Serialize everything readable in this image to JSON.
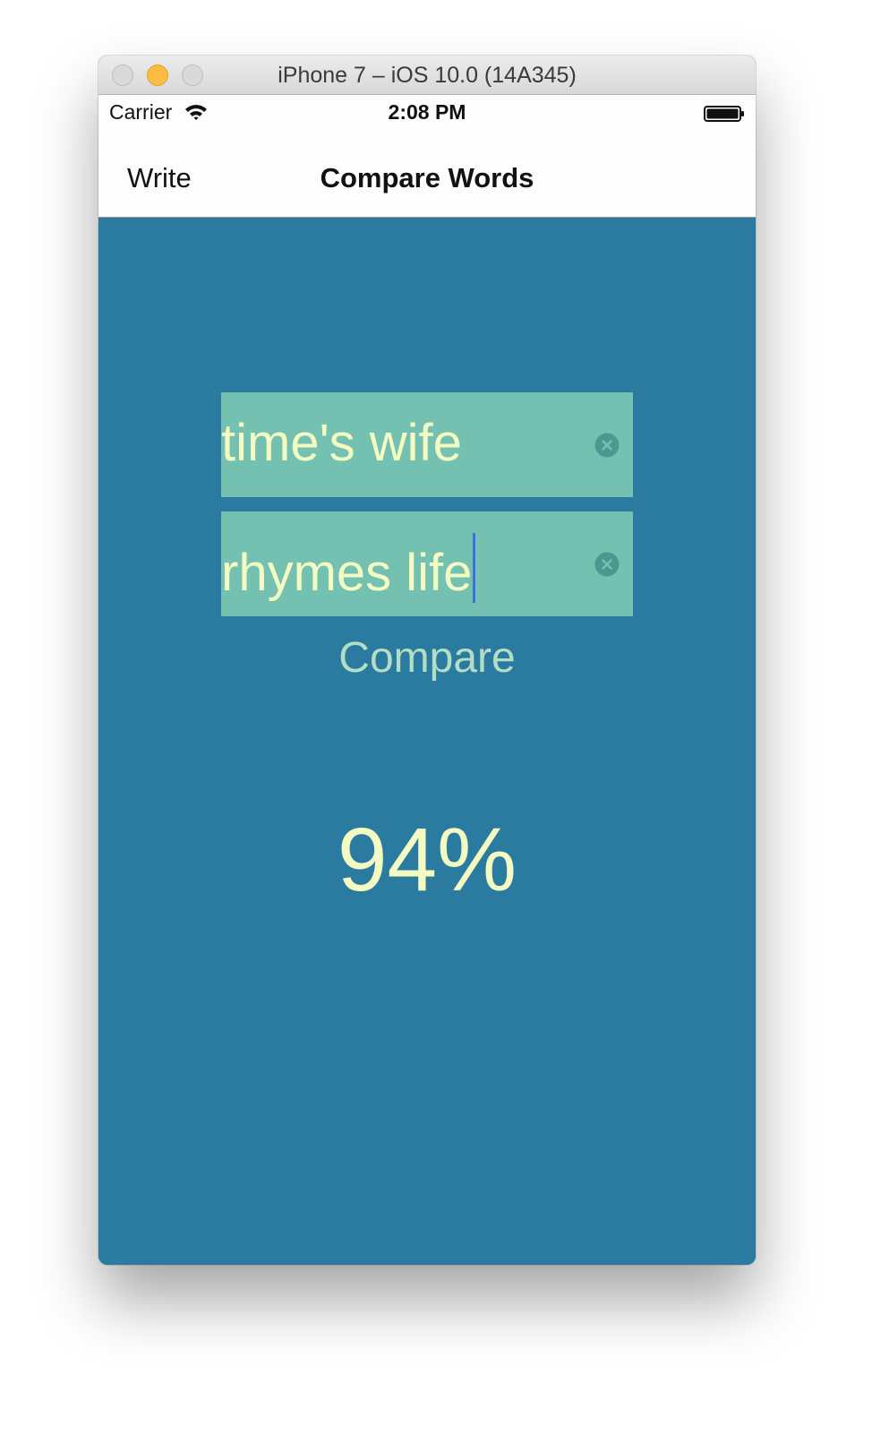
{
  "window": {
    "title": "iPhone 7 – iOS 10.0 (14A345)"
  },
  "status_bar": {
    "carrier": "Carrier",
    "time": "2:08 PM",
    "icons": [
      "wifi-icon",
      "battery-icon"
    ]
  },
  "nav": {
    "back_label": "Write",
    "title": "Compare Words"
  },
  "fields": {
    "first": {
      "value": "time's wife",
      "clear_icon": "clear-icon"
    },
    "second": {
      "value": "rhymes life",
      "clear_icon": "clear-icon",
      "focused": true
    }
  },
  "compare_label": "Compare",
  "result": "94%",
  "colors": {
    "background": "#2a7b9f",
    "field_background": "#74c1b1",
    "field_text": "#f3fbc2",
    "button_text": "#b4ddc5",
    "caret": "#3c6fe6"
  }
}
